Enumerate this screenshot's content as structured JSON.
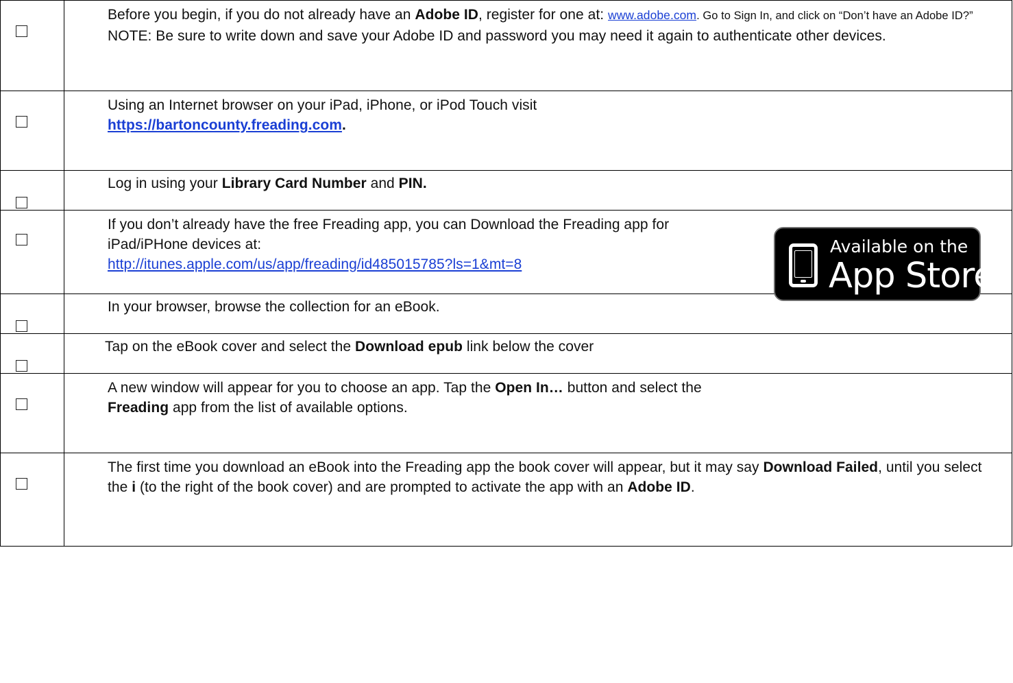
{
  "steps": [
    {
      "parts": [
        {
          "text": "Before you begin, if you do not already have an "
        },
        {
          "text": "Adobe ID",
          "bold": true
        },
        {
          "text": ", register for one at: "
        },
        {
          "text": "www.adobe.com",
          "link": true,
          "small": true
        },
        {
          "text": ". Go to Sign In, and click on “Don’t have an Adobe ID?”",
          "small": true
        },
        {
          "text": "  NOTE: Be sure to write down and save your Adobe ID and password you may need it again to authenticate other devices."
        }
      ]
    },
    {
      "parts": [
        {
          "text": "Using an Internet browser on your iPad, iPhone, or iPod Touch visit "
        },
        {
          "text": "https://bartoncounty.freading.com",
          "link": true,
          "bold": true,
          "newline": true
        },
        {
          "text": ".",
          "bold": true
        }
      ]
    },
    {
      "parts": [
        {
          "text": "Log in using your "
        },
        {
          "text": "Library Card Number",
          "bold": true
        },
        {
          "text": " and "
        },
        {
          "text": "PIN.",
          "bold": true
        }
      ]
    },
    {
      "parts": [
        {
          "text": "If you don’t already have the free Freading app, you can Download the Freading app for"
        },
        {
          "text": "iPad/iPHone devices at:",
          "newline": true
        },
        {
          "text": "http://itunes.apple.com/us/app/freading/id485015785?ls=1&mt=8",
          "link": true,
          "newline": true
        }
      ],
      "badge": {
        "line1": "Available on the",
        "line2": "App Store",
        "icon": "phone-icon"
      }
    },
    {
      "parts": [
        {
          "text": "In your browser, browse the collection for an eBook."
        }
      ]
    },
    {
      "parts": [
        {
          "text": "Tap on the eBook cover and select the "
        },
        {
          "text": "Download epub",
          "bold": true
        },
        {
          "text": " link below the cover"
        }
      ]
    },
    {
      "parts": [
        {
          "text": "A new window will appear for you to choose an app. Tap the "
        },
        {
          "text": "Open In…",
          "bold": true
        },
        {
          "text": " button and select the"
        },
        {
          "text": "Freading",
          "bold": true,
          "newline": true
        },
        {
          "text": " app from the list of available options."
        }
      ]
    },
    {
      "parts": [
        {
          "text": "The first time you download an eBook into the Freading app the book cover will appear, but it may say "
        },
        {
          "text": "Download Failed",
          "bold": true
        },
        {
          "text": ", until you select the "
        },
        {
          "text": "i",
          "bold": true
        },
        {
          "text": " (to the right of the book cover) and are prompted to activate the app with an "
        },
        {
          "text": "Adobe ID",
          "bold": true
        },
        {
          "text": "."
        }
      ]
    }
  ]
}
